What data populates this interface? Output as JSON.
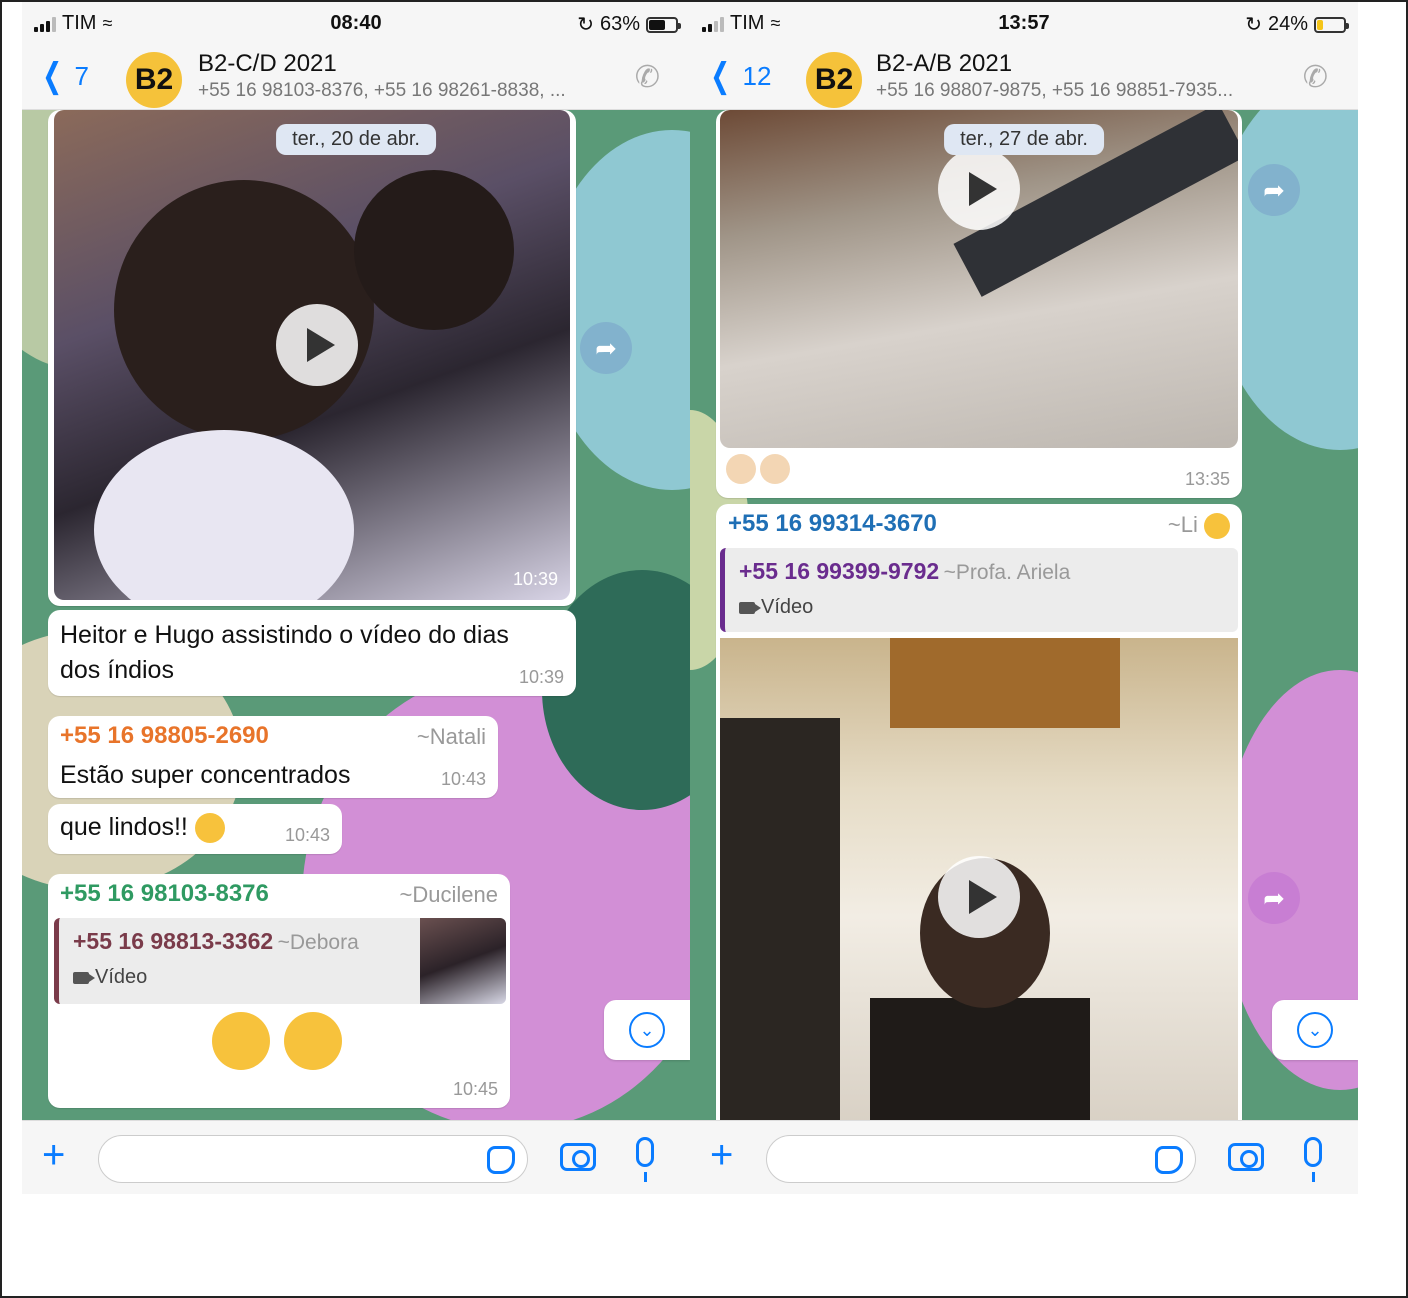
{
  "left": {
    "status": {
      "carrier": "TIM",
      "time": "08:40",
      "battery": "63%",
      "battery_level": 0.63
    },
    "header": {
      "back_count": "7",
      "avatar": "B2",
      "title": "B2-C/D 2021",
      "subtitle": "+55 16 98103-8376, +55 16 98261-8838, ..."
    },
    "date_pill": "ter., 20 de abr.",
    "video_message": {
      "time": "10:39"
    },
    "caption_message": {
      "text": "Heitor e Hugo assistindo o vídeo do dias dos índios",
      "time": "10:39"
    },
    "natali_message": {
      "sender": "+55 16 98805-2690",
      "alias": "~Natali",
      "text": "Estão super concentrados",
      "time": "10:43"
    },
    "lindos_message": {
      "text": "que lindos!!",
      "time": "10:43"
    },
    "reply_message": {
      "sender": "+55 16 98103-8376",
      "alias": "~Ducilene",
      "quote_sender": "+55 16 98813-3362",
      "quote_alias": "~Debora",
      "quote_type": "Vídeo",
      "time": "10:45"
    },
    "colors": {
      "natali_sender": "#e8742a",
      "reply_sender": "#2f9a62",
      "quote_sender": "#7a3b4a"
    }
  },
  "right": {
    "status": {
      "carrier": "TIM",
      "time": "13:57",
      "battery": "24%",
      "battery_level": 0.24
    },
    "header": {
      "back_count": "12",
      "avatar": "B2",
      "title": "B2-A/B 2021",
      "subtitle": "+55 16 98807-9875, +55 16 98851-7935..."
    },
    "date_pill": "ter., 27 de abr.",
    "video_message": {
      "time": "13:35"
    },
    "forward_message": {
      "sender": "+55 16 99314-3670",
      "alias": "~Li",
      "quote_sender": "+55 16 99399-9792",
      "quote_alias": "~Profa. Ariela",
      "quote_type": "Vídeo"
    },
    "colors": {
      "sender": "#1f6fb5",
      "quote_sender": "#6a2c8e"
    }
  },
  "icons": {
    "signal": "signal-bars-icon",
    "wifi": "wifi-icon",
    "rotation_lock": "rotation-lock-icon",
    "back": "chevron-left-icon",
    "call": "add-call-icon",
    "play": "play-icon",
    "forward": "forward-arrow-icon",
    "scroll_down": "chevron-down-icon",
    "attach": "plus-icon",
    "sticker": "sticker-icon",
    "camera": "camera-icon",
    "mic": "microphone-icon"
  }
}
